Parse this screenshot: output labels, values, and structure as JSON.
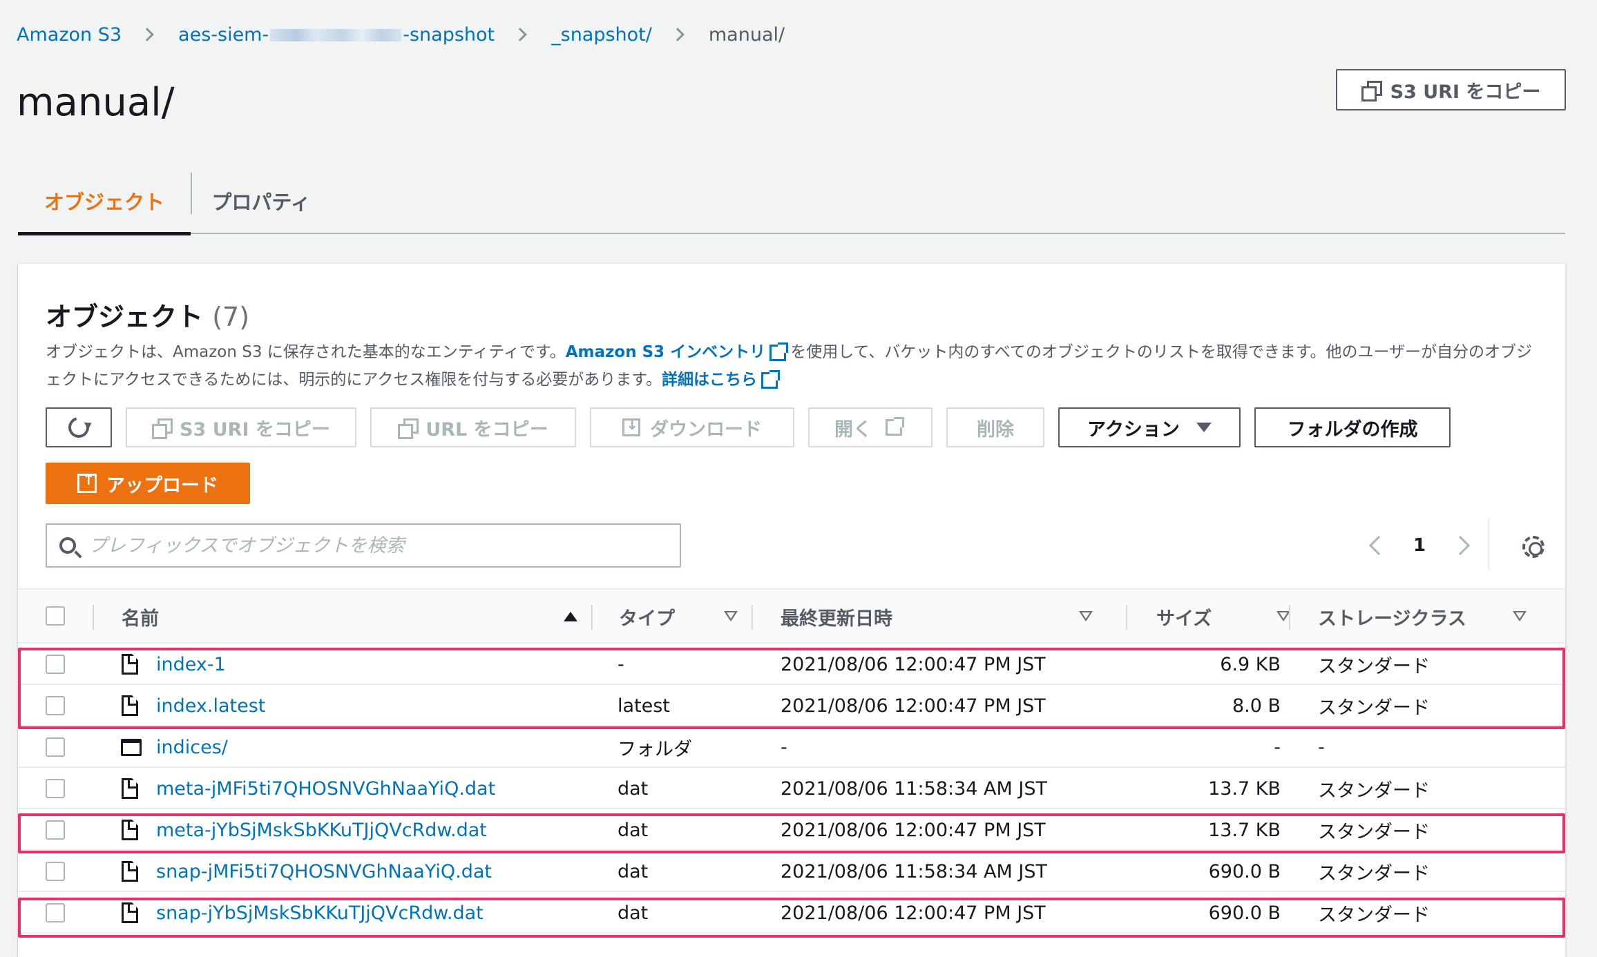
{
  "breadcrumb": {
    "root": "Amazon S3",
    "bucket_prefix": "aes-siem-",
    "bucket_suffix": "-snapshot",
    "folder": "_snapshot/",
    "current": "manual/"
  },
  "page_title": "manual/",
  "copy_uri_top": "S3 URI をコピー",
  "tabs": [
    {
      "label": "オブジェクト",
      "active": true
    },
    {
      "label": "プロパティ",
      "active": false
    }
  ],
  "panel": {
    "title": "オブジェクト",
    "count": "(7)",
    "desc_part1": "オブジェクトは、Amazon S3 に保存された基本的なエンティティです。",
    "desc_link1": "Amazon S3 インベントリ",
    "desc_part2": "を使用して、バケット内のすべてのオブジェクトのリストを取得できます。他のユーザーが自分のオブジェクトにアクセスできるためには、明示的にアクセス権限を付与する必要があります。",
    "desc_link2": "詳細はこちら"
  },
  "toolbar": {
    "copy_s3_uri": "S3 URI をコピー",
    "copy_url": "URL をコピー",
    "download": "ダウンロード",
    "open": "開く",
    "delete": "削除",
    "actions": "アクション",
    "create_folder": "フォルダの作成",
    "upload": "アップロード"
  },
  "search": {
    "placeholder": "プレフィックスでオブジェクトを検索"
  },
  "pagination": {
    "page": "1"
  },
  "columns": {
    "name": "名前",
    "type": "タイプ",
    "modified": "最終更新日時",
    "size": "サイズ",
    "storage": "ストレージクラス"
  },
  "rows": [
    {
      "name": "index-1",
      "kind": "file",
      "type": "-",
      "modified": "2021/08/06 12:00:47 PM JST",
      "size": "6.9 KB",
      "storage": "スタンダード",
      "highlighted": true
    },
    {
      "name": "index.latest",
      "kind": "file",
      "type": "latest",
      "modified": "2021/08/06 12:00:47 PM JST",
      "size": "8.0 B",
      "storage": "スタンダード",
      "highlighted": true
    },
    {
      "name": "indices/",
      "kind": "folder",
      "type": "フォルダ",
      "modified": "-",
      "size": "-",
      "storage": "-",
      "highlighted": false
    },
    {
      "name": "meta-jMFi5ti7QHOSNVGhNaaYiQ.dat",
      "kind": "file",
      "type": "dat",
      "modified": "2021/08/06 11:58:34 AM JST",
      "size": "13.7 KB",
      "storage": "スタンダード",
      "highlighted": false
    },
    {
      "name": "meta-jYbSjMskSbKKuTJjQVcRdw.dat",
      "kind": "file",
      "type": "dat",
      "modified": "2021/08/06 12:00:47 PM JST",
      "size": "13.7 KB",
      "storage": "スタンダード",
      "highlighted": true
    },
    {
      "name": "snap-jMFi5ti7QHOSNVGhNaaYiQ.dat",
      "kind": "file",
      "type": "dat",
      "modified": "2021/08/06 11:58:34 AM JST",
      "size": "690.0 B",
      "storage": "スタンダード",
      "highlighted": false
    },
    {
      "name": "snap-jYbSjMskSbKKuTJjQVcRdw.dat",
      "kind": "file",
      "type": "dat",
      "modified": "2021/08/06 12:00:47 PM JST",
      "size": "690.0 B",
      "storage": "スタンダード",
      "highlighted": true
    }
  ],
  "colors": {
    "accent": "#ec7211",
    "link": "#0073bb",
    "highlight": "#e7306e"
  }
}
